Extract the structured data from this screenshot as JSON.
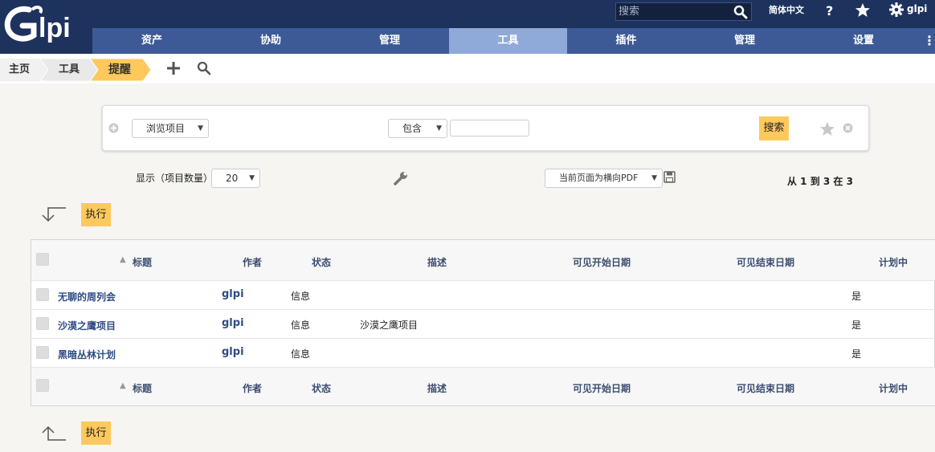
{
  "app": {
    "logo_text": "Glpi"
  },
  "topbar": {
    "search_placeholder": "搜索",
    "language": "简体中文",
    "help_icon": "help-icon",
    "favorite_icon": "star-icon",
    "username": "glpi"
  },
  "nav": {
    "items": [
      {
        "label": "资产",
        "active": false
      },
      {
        "label": "协助",
        "active": false
      },
      {
        "label": "管理",
        "active": false
      },
      {
        "label": "工具",
        "active": true
      },
      {
        "label": "插件",
        "active": false
      },
      {
        "label": "管理",
        "active": false
      },
      {
        "label": "设置",
        "active": false
      }
    ]
  },
  "breadcrumb": {
    "items": [
      "主页",
      "工具",
      "提醒"
    ]
  },
  "searchpanel": {
    "field_select": "浏览项目",
    "operator_select": "包含",
    "value": "",
    "search_button": "搜索"
  },
  "list_controls": {
    "display_label": "显示（项目数量）",
    "page_size": "20",
    "export_select": "当前页面为横向PDF",
    "pagination": "从 1 到 3 在 3"
  },
  "actions": {
    "execute_label": "执行"
  },
  "table": {
    "columns": [
      "标题",
      "作者",
      "状态",
      "描述",
      "可见开始日期",
      "可见结束日期",
      "计划中"
    ],
    "rows": [
      {
        "title": "无聊的周列会",
        "author": "glpi",
        "status": "信息",
        "description": "",
        "start": "",
        "end": "",
        "planned": "是"
      },
      {
        "title": "沙漠之鹰项目",
        "author": "glpi",
        "status": "信息",
        "description": "沙漠之鹰项目",
        "start": "",
        "end": "",
        "planned": "是"
      },
      {
        "title": "黑暗丛林计划",
        "author": "glpi",
        "status": "信息",
        "description": "",
        "start": "",
        "end": "",
        "planned": "是"
      }
    ]
  },
  "colors": {
    "topbar": "#1e325e",
    "nav": "#3d5a96",
    "nav_active": "#8fa9d8",
    "accent": "#fec95c",
    "link": "#2f4c83"
  }
}
